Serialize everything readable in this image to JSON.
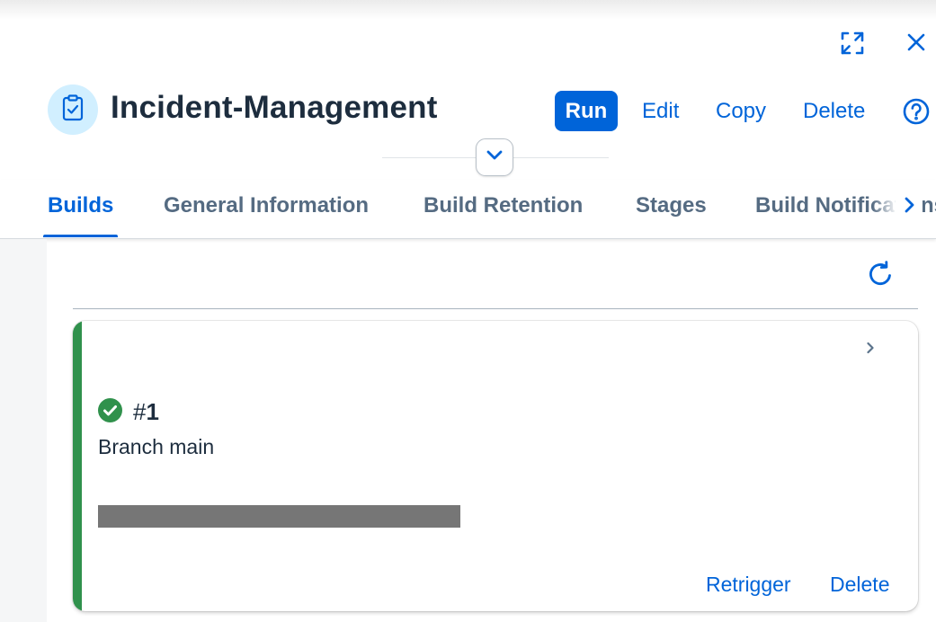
{
  "header": {
    "title": "Incident-Management",
    "avatar_icon": "clipboard-check-icon",
    "actions": {
      "run": "Run",
      "edit": "Edit",
      "copy": "Copy",
      "delete": "Delete"
    },
    "help_icon": "help-circle-icon",
    "expand_icon": "fullscreen-icon",
    "close_icon": "close-icon",
    "collapse_icon": "chevron-down-icon"
  },
  "tabs": [
    {
      "label": "Builds",
      "active": true
    },
    {
      "label": "General Information",
      "active": false
    },
    {
      "label": "Build Retention",
      "active": false
    },
    {
      "label": "Stages",
      "active": false
    },
    {
      "label": "Build Notifications",
      "active": false
    }
  ],
  "builds": {
    "refresh_icon": "refresh-icon",
    "items": [
      {
        "status": "success",
        "hash": "#",
        "number": "1",
        "branch_text": "Branch main",
        "actions": {
          "retrigger": "Retrigger",
          "delete": "Delete"
        }
      }
    ]
  },
  "colors": {
    "accent": "#0064d9",
    "success": "#30914c",
    "text": "#1d2d3e",
    "tab_inactive": "#556b82",
    "avatar_bg": "#d1efff"
  }
}
